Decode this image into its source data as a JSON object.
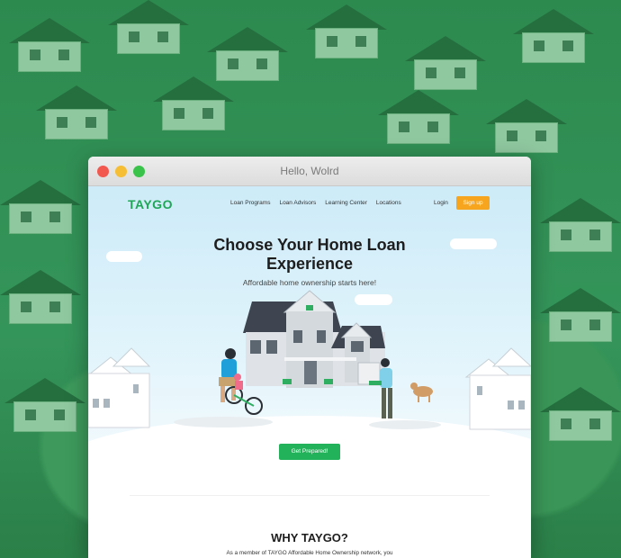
{
  "window": {
    "title": "Hello, Wolrd"
  },
  "nav": {
    "logo": "TAYGO",
    "items": [
      "Loan Programs",
      "Loan Advisors",
      "Learning Center",
      "Locations"
    ],
    "login": "Login",
    "signup": "Sign up"
  },
  "hero": {
    "title": "Choose Your Home Loan Experience",
    "subtitle": "Affordable home ownership starts here!",
    "cta": "Get Prepared!"
  },
  "why": {
    "title": "WHY TAYGO?",
    "text": "As a member of TAYGO Affordable Home Ownership network, you will have access a variety of services to help you prepare and maximize the chance of qualifying for the home loan you desire"
  },
  "colors": {
    "brand": "#1fa657",
    "accent": "#f7a51e",
    "cta": "#22b35a"
  }
}
